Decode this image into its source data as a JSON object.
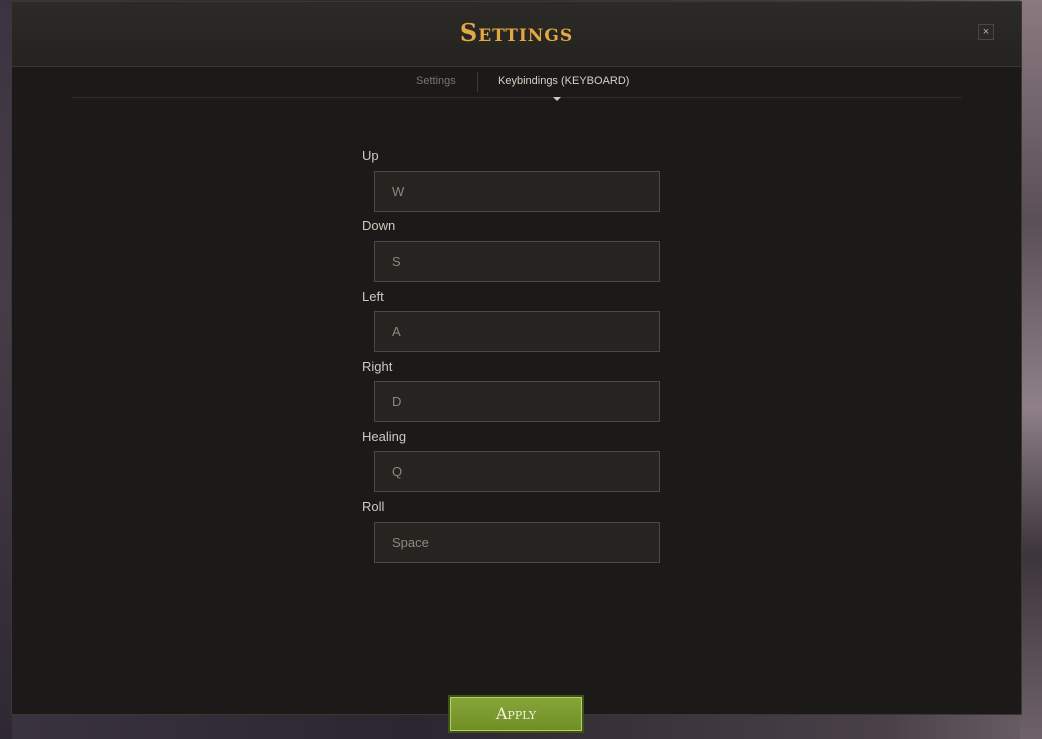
{
  "dialog": {
    "title": "Settings",
    "close_label": "×"
  },
  "tabs": [
    {
      "label": "Settings",
      "active": false
    },
    {
      "label": "Keybindings (KEYBOARD)",
      "active": true
    }
  ],
  "bindings": [
    {
      "label": "Up",
      "value": "W"
    },
    {
      "label": "Down",
      "value": "S"
    },
    {
      "label": "Left",
      "value": "A"
    },
    {
      "label": "Right",
      "value": "D"
    },
    {
      "label": "Healing",
      "value": "Q"
    },
    {
      "label": "Roll",
      "value": "Space"
    }
  ],
  "footer": {
    "apply_label": "Apply"
  },
  "colors": {
    "title_gold": "#e3a744",
    "apply_green": "#7a9a2e",
    "panel_bg": "#1b1a18"
  }
}
